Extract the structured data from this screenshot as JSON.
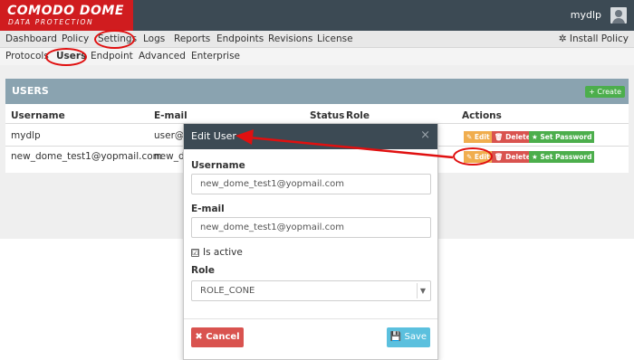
{
  "app": {
    "logo_line1": "COMODO DOME",
    "logo_line2": "DATA PROTECTION",
    "user_name": "mydlp"
  },
  "menu": {
    "items": [
      "Dashboard",
      "Policy",
      "Settings",
      "Logs",
      "Reports",
      "Endpoints",
      "Revisions",
      "License"
    ],
    "install": "Install Policy"
  },
  "submenu": {
    "items": [
      "Protocols",
      "Users",
      "Endpoint",
      "Advanced",
      "Enterprise"
    ]
  },
  "users_panel": {
    "title": "USERS",
    "create_label": "+ Create",
    "columns": [
      "Username",
      "E-mail",
      "Status",
      "Role",
      "Actions"
    ],
    "rows": [
      {
        "username": "mydlp",
        "email": "user@r"
      },
      {
        "username": "new_dome_test1@yopmail.com",
        "email": "new_do"
      }
    ],
    "actions": {
      "edit": "Edit",
      "delete": "Delete",
      "set_password": "Set Password"
    }
  },
  "modal": {
    "title": "Edit User",
    "close": "×",
    "username_label": "Username",
    "username_value": "new_dome_test1@yopmail.com",
    "email_label": "E-mail",
    "email_value": "new_dome_test1@yopmail.com",
    "is_active_label": "Is active",
    "is_active_checked": "☑",
    "role_label": "Role",
    "role_value": "ROLE_CONE",
    "cancel_label": "✖ Cancel",
    "save_label": "💾 Save"
  },
  "colors": {
    "accent_red": "#e01010",
    "topbar": "#3c4a54",
    "brand": "#d01c1f"
  }
}
